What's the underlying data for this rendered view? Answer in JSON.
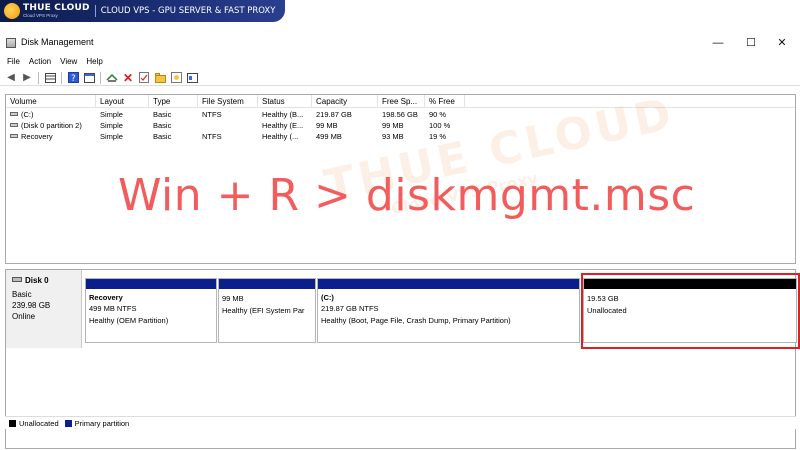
{
  "banner": {
    "brand": "THUE CLOUD",
    "brand_sub": "Cloud VPS Proxy",
    "tagline": "CLOUD VPS - GPU SERVER & FAST PROXY"
  },
  "window": {
    "title": "Disk Management",
    "minimize": "—",
    "maximize": "☐",
    "close": "✕"
  },
  "menu": [
    "File",
    "Action",
    "View",
    "Help"
  ],
  "toolbar_icons": [
    "back-icon",
    "forward-icon",
    "list-view-icon",
    "help-icon",
    "properties-icon",
    "connect-icon",
    "delete-icon",
    "check-icon",
    "folder-icon",
    "rescan-icon",
    "settings-icon"
  ],
  "volume_list": {
    "columns": [
      "Volume",
      "Layout",
      "Type",
      "File System",
      "Status",
      "Capacity",
      "Free Sp...",
      "% Free"
    ],
    "rows": [
      [
        "(C:)",
        "Simple",
        "Basic",
        "NTFS",
        "Healthy (B...",
        "219.87 GB",
        "198.56 GB",
        "90 %"
      ],
      [
        "(Disk 0 partition 2)",
        "Simple",
        "Basic",
        "",
        "Healthy (E...",
        "99 MB",
        "99 MB",
        "100 %"
      ],
      [
        "Recovery",
        "Simple",
        "Basic",
        "NTFS",
        "Healthy (...",
        "499 MB",
        "93 MB",
        "19 %"
      ]
    ]
  },
  "overlay_text": "Win + R > diskmgmt.msc",
  "watermark": {
    "line1": "THUE CLOUD",
    "line2": "Cloud VPS Proxy"
  },
  "disk": {
    "name": "Disk 0",
    "type": "Basic",
    "size": "239.98 GB",
    "status": "Online",
    "partitions": [
      {
        "name": "Recovery",
        "size": "499 MB NTFS",
        "status": "Healthy (OEM Partition)",
        "kind": "primary"
      },
      {
        "name": "",
        "size": "99 MB",
        "status": "Healthy (EFI System Par",
        "kind": "primary"
      },
      {
        "name": "(C:)",
        "size": "219.87 GB NTFS",
        "status": "Healthy (Boot, Page File, Crash Dump, Primary Partition)",
        "kind": "primary"
      },
      {
        "name": "",
        "size": "19.53 GB",
        "status": "Unallocated",
        "kind": "unallocated"
      }
    ]
  },
  "legend": [
    {
      "label": "Unallocated",
      "color": "#000000"
    },
    {
      "label": "Primary partition",
      "color": "#0a1e8c"
    }
  ]
}
